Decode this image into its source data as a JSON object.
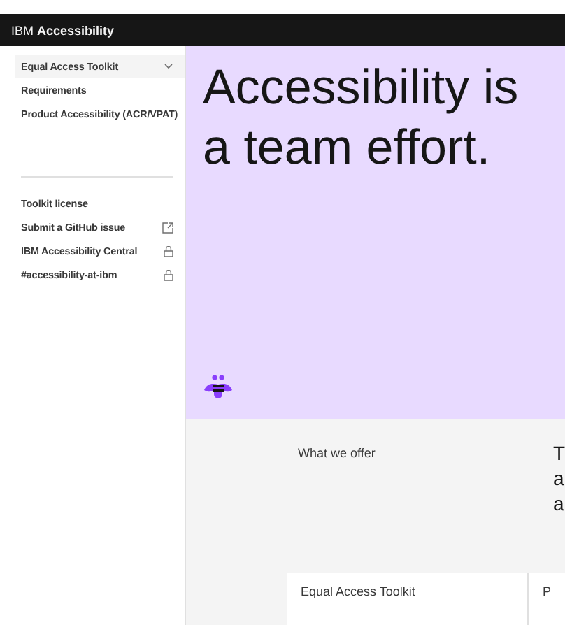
{
  "header": {
    "title": "IBM **Accessibility**"
  },
  "sidebar": {
    "items": [
      {
        "label": "Equal Access Toolkit",
        "kind": "menu"
      },
      {
        "label": "Requirements",
        "kind": "link"
      },
      {
        "label": "Product Accessibility (ACR/VPAT)",
        "kind": "link"
      }
    ],
    "resources": [
      {
        "label": "Toolkit license",
        "kind": "link"
      },
      {
        "label": "Submit a GitHub issue",
        "kind": "external"
      },
      {
        "label": "IBM Accessibility Central",
        "kind": "locked"
      },
      {
        "label": "#accessibility-at-ibm",
        "kind": "locked"
      }
    ]
  },
  "hero": {
    "title": "Accessibility is a team effort."
  },
  "offer": {
    "label": "What we offer",
    "text_lines": [
      "T",
      "a",
      "a"
    ],
    "cards": [
      {
        "title": "Equal Access Toolkit"
      },
      {
        "title": "P"
      }
    ]
  }
}
